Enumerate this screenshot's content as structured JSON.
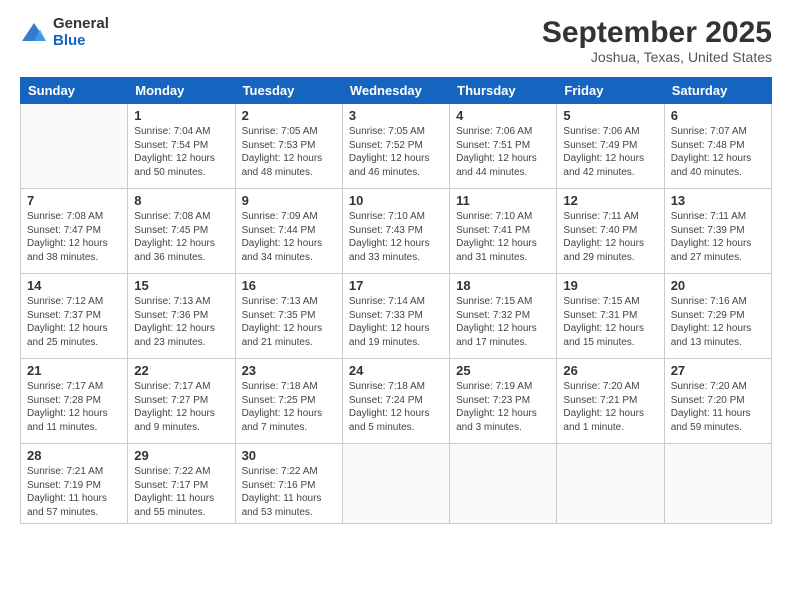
{
  "logo": {
    "general": "General",
    "blue": "Blue"
  },
  "header": {
    "month": "September 2025",
    "location": "Joshua, Texas, United States"
  },
  "weekdays": [
    "Sunday",
    "Monday",
    "Tuesday",
    "Wednesday",
    "Thursday",
    "Friday",
    "Saturday"
  ],
  "weeks": [
    [
      {
        "day": "",
        "info": ""
      },
      {
        "day": "1",
        "info": "Sunrise: 7:04 AM\nSunset: 7:54 PM\nDaylight: 12 hours\nand 50 minutes."
      },
      {
        "day": "2",
        "info": "Sunrise: 7:05 AM\nSunset: 7:53 PM\nDaylight: 12 hours\nand 48 minutes."
      },
      {
        "day": "3",
        "info": "Sunrise: 7:05 AM\nSunset: 7:52 PM\nDaylight: 12 hours\nand 46 minutes."
      },
      {
        "day": "4",
        "info": "Sunrise: 7:06 AM\nSunset: 7:51 PM\nDaylight: 12 hours\nand 44 minutes."
      },
      {
        "day": "5",
        "info": "Sunrise: 7:06 AM\nSunset: 7:49 PM\nDaylight: 12 hours\nand 42 minutes."
      },
      {
        "day": "6",
        "info": "Sunrise: 7:07 AM\nSunset: 7:48 PM\nDaylight: 12 hours\nand 40 minutes."
      }
    ],
    [
      {
        "day": "7",
        "info": "Sunrise: 7:08 AM\nSunset: 7:47 PM\nDaylight: 12 hours\nand 38 minutes."
      },
      {
        "day": "8",
        "info": "Sunrise: 7:08 AM\nSunset: 7:45 PM\nDaylight: 12 hours\nand 36 minutes."
      },
      {
        "day": "9",
        "info": "Sunrise: 7:09 AM\nSunset: 7:44 PM\nDaylight: 12 hours\nand 34 minutes."
      },
      {
        "day": "10",
        "info": "Sunrise: 7:10 AM\nSunset: 7:43 PM\nDaylight: 12 hours\nand 33 minutes."
      },
      {
        "day": "11",
        "info": "Sunrise: 7:10 AM\nSunset: 7:41 PM\nDaylight: 12 hours\nand 31 minutes."
      },
      {
        "day": "12",
        "info": "Sunrise: 7:11 AM\nSunset: 7:40 PM\nDaylight: 12 hours\nand 29 minutes."
      },
      {
        "day": "13",
        "info": "Sunrise: 7:11 AM\nSunset: 7:39 PM\nDaylight: 12 hours\nand 27 minutes."
      }
    ],
    [
      {
        "day": "14",
        "info": "Sunrise: 7:12 AM\nSunset: 7:37 PM\nDaylight: 12 hours\nand 25 minutes."
      },
      {
        "day": "15",
        "info": "Sunrise: 7:13 AM\nSunset: 7:36 PM\nDaylight: 12 hours\nand 23 minutes."
      },
      {
        "day": "16",
        "info": "Sunrise: 7:13 AM\nSunset: 7:35 PM\nDaylight: 12 hours\nand 21 minutes."
      },
      {
        "day": "17",
        "info": "Sunrise: 7:14 AM\nSunset: 7:33 PM\nDaylight: 12 hours\nand 19 minutes."
      },
      {
        "day": "18",
        "info": "Sunrise: 7:15 AM\nSunset: 7:32 PM\nDaylight: 12 hours\nand 17 minutes."
      },
      {
        "day": "19",
        "info": "Sunrise: 7:15 AM\nSunset: 7:31 PM\nDaylight: 12 hours\nand 15 minutes."
      },
      {
        "day": "20",
        "info": "Sunrise: 7:16 AM\nSunset: 7:29 PM\nDaylight: 12 hours\nand 13 minutes."
      }
    ],
    [
      {
        "day": "21",
        "info": "Sunrise: 7:17 AM\nSunset: 7:28 PM\nDaylight: 12 hours\nand 11 minutes."
      },
      {
        "day": "22",
        "info": "Sunrise: 7:17 AM\nSunset: 7:27 PM\nDaylight: 12 hours\nand 9 minutes."
      },
      {
        "day": "23",
        "info": "Sunrise: 7:18 AM\nSunset: 7:25 PM\nDaylight: 12 hours\nand 7 minutes."
      },
      {
        "day": "24",
        "info": "Sunrise: 7:18 AM\nSunset: 7:24 PM\nDaylight: 12 hours\nand 5 minutes."
      },
      {
        "day": "25",
        "info": "Sunrise: 7:19 AM\nSunset: 7:23 PM\nDaylight: 12 hours\nand 3 minutes."
      },
      {
        "day": "26",
        "info": "Sunrise: 7:20 AM\nSunset: 7:21 PM\nDaylight: 12 hours\nand 1 minute."
      },
      {
        "day": "27",
        "info": "Sunrise: 7:20 AM\nSunset: 7:20 PM\nDaylight: 11 hours\nand 59 minutes."
      }
    ],
    [
      {
        "day": "28",
        "info": "Sunrise: 7:21 AM\nSunset: 7:19 PM\nDaylight: 11 hours\nand 57 minutes."
      },
      {
        "day": "29",
        "info": "Sunrise: 7:22 AM\nSunset: 7:17 PM\nDaylight: 11 hours\nand 55 minutes."
      },
      {
        "day": "30",
        "info": "Sunrise: 7:22 AM\nSunset: 7:16 PM\nDaylight: 11 hours\nand 53 minutes."
      },
      {
        "day": "",
        "info": ""
      },
      {
        "day": "",
        "info": ""
      },
      {
        "day": "",
        "info": ""
      },
      {
        "day": "",
        "info": ""
      }
    ]
  ]
}
